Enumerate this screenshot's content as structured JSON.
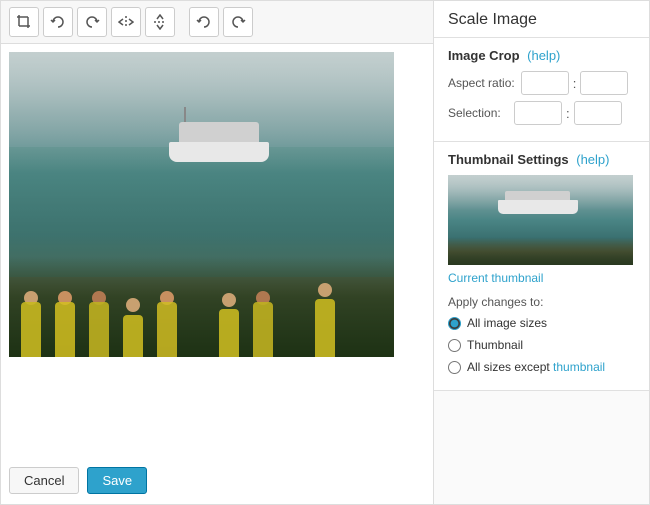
{
  "header": {
    "title": "Scale Image"
  },
  "toolbar": {
    "buttons": [
      {
        "name": "crop-icon",
        "label": "✛",
        "title": "Crop"
      },
      {
        "name": "rotate-left-icon",
        "label": "⟳",
        "title": "Rotate Left"
      },
      {
        "name": "rotate-right-icon",
        "label": "⟳",
        "title": "Rotate Right"
      },
      {
        "name": "flip-horizontal-icon",
        "label": "⇔",
        "title": "Flip Horizontal"
      },
      {
        "name": "flip-vertical-icon",
        "label": "⇕",
        "title": "Flip Vertical"
      },
      {
        "name": "undo-icon",
        "label": "↩",
        "title": "Undo"
      },
      {
        "name": "redo-icon",
        "label": "↪",
        "title": "Redo"
      }
    ]
  },
  "image_crop": {
    "section_title": "Image Crop",
    "help_label": "(help)",
    "aspect_ratio_label": "Aspect ratio:",
    "aspect_ratio_x": "",
    "aspect_ratio_y": "",
    "selection_label": "Selection:",
    "selection_x": "",
    "selection_y": ""
  },
  "thumbnail_settings": {
    "section_title": "Thumbnail Settings",
    "help_label": "(help)",
    "current_thumbnail_label": "Current thumbnail"
  },
  "apply_changes": {
    "title": "Apply changes to:",
    "options": [
      {
        "id": "all-sizes",
        "label": "All image sizes",
        "checked": true
      },
      {
        "id": "thumbnail",
        "label": "Thumbnail",
        "checked": false
      },
      {
        "id": "all-except",
        "label1": "All sizes except",
        "label2": "thumbnail",
        "checked": false
      }
    ]
  },
  "actions": {
    "cancel_label": "Cancel",
    "save_label": "Save"
  },
  "separator": ":"
}
